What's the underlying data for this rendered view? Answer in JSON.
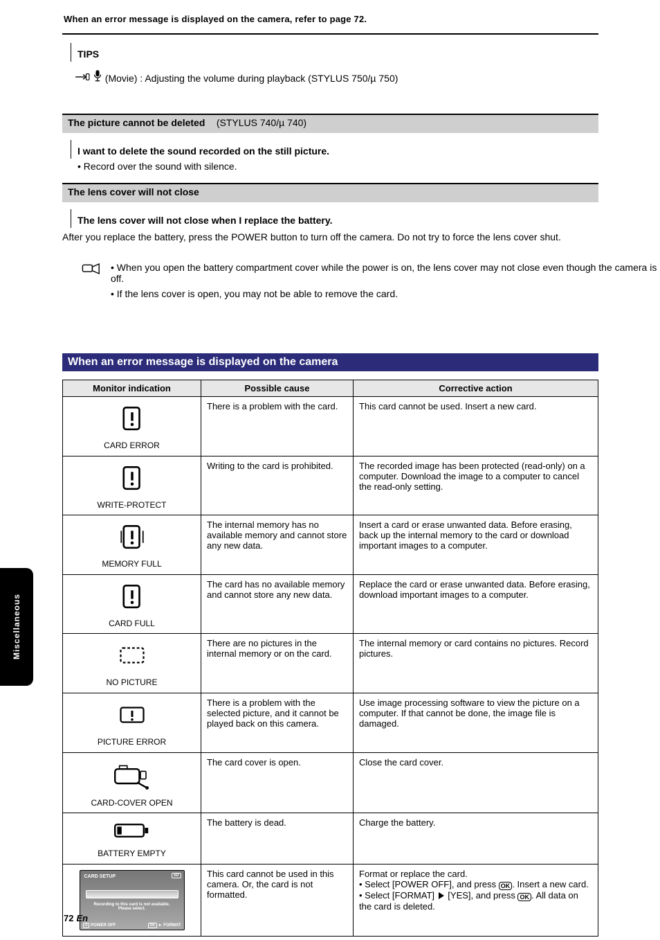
{
  "header": "When an error message is displayed on the camera, refer to page 72.",
  "page_number_prefix": "72",
  "page_number_suffix": "En",
  "side_tab_label": "Miscellaneous",
  "tip": {
    "label": "TIPS",
    "text": "(Movie) : Adjusting the volume during playback (STYLUS 750/µ 750)"
  },
  "cannot_delete": {
    "bar_main": "The picture cannot be deleted",
    "bar_sub": "(STYLUS 740/µ 740)",
    "q": "I want to delete the sound recorded on the still picture.",
    "a": "• Record over the sound with silence."
  },
  "cannot_close": {
    "bar": "The lens cover will not close",
    "q": "The lens cover will not close when I replace the battery.",
    "a": "After you replace the battery, press the POWER button to turn off the camera. Do not try to force the lens cover shut.",
    "points": [
      "• When you open the battery compartment cover while the power is on, the lens cover may not close even though the camera is off.",
      "• If the lens cover is open, you may not be able to remove the card."
    ]
  },
  "err_section": {
    "title": "When an error message is displayed on the camera",
    "cols": {
      "ind": "Monitor indication",
      "exp": "Possible cause",
      "act": "Corrective action"
    },
    "rows": [
      {
        "icon": "card-error",
        "ind": "CARD ERROR",
        "exp": "There is a problem with the card.",
        "act": "This card cannot be used. Insert a new card."
      },
      {
        "icon": "card-error",
        "ind": "WRITE-PROTECT",
        "exp": "Writing to the card is prohibited.",
        "act": "The recorded image has been protected (read-only) on a computer. Download the image to a computer to cancel the read-only setting."
      },
      {
        "icon": "memory-full",
        "ind": "MEMORY FULL",
        "exp": "The internal memory has no available memory and cannot store any new data.",
        "act": "Insert a card or erase unwanted data. Before erasing, back up the internal memory to the card or download important images to a computer."
      },
      {
        "icon": "card-error",
        "ind": "CARD FULL",
        "exp": "The card has no available memory and cannot store any new data.",
        "act": "Replace the card or erase unwanted data. Before erasing, download important images to a computer."
      },
      {
        "icon": "no-picture-dashed",
        "ind": "NO PICTURE",
        "exp": "There are no pictures in the internal memory or on the card.",
        "act": "The internal memory or card contains no pictures. Record pictures."
      },
      {
        "icon": "picture-error",
        "ind": "PICTURE ERROR",
        "exp": "There is a problem with the selected picture, and it cannot be played back on this camera.",
        "act": "Use image processing software to view the picture on a computer. If that cannot be done, the image file is damaged."
      },
      {
        "icon": "cover-open",
        "ind": "CARD-COVER OPEN",
        "exp": "The card cover is open.",
        "act": "Close the card cover."
      },
      {
        "icon": "battery-empty",
        "ind": "BATTERY EMPTY",
        "exp": "The battery is dead.",
        "act": "Charge the battery."
      },
      {
        "icon": "card-setup-ui",
        "ind_lines": [],
        "exp": "This card cannot be used in this camera. Or, the card is not formatted.",
        "act_parts": {
          "a": "Format or replace the card.",
          "b": "• Select [POWER OFF], and press ",
          "ok1": "OK",
          "c": ". Insert a new card.",
          "d": "• Select [FORMAT] ",
          "e": " [YES], and press ",
          "ok2": "OK",
          "f": ". All data on the card is deleted."
        },
        "cam_ui": {
          "title": "CARD SETUP",
          "xd": "xD",
          "msg1": "Recording to this card is not available.",
          "msg2": "Please select.",
          "foot_left": "POWER OFF",
          "foot_ok": "OK",
          "foot_right": "FORMAT"
        }
      }
    ]
  }
}
